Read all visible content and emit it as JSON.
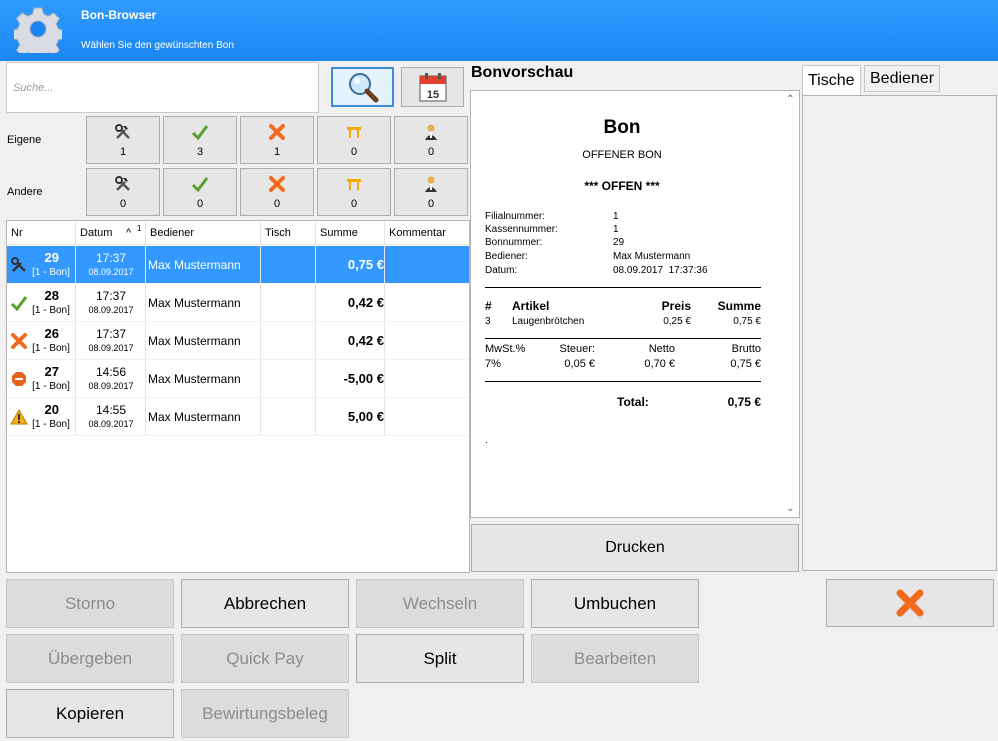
{
  "window": {
    "title": "Bon-Browser",
    "subtitle": "Wählen Sie den gewünschten Bon"
  },
  "search": {
    "placeholder": "Suche..."
  },
  "calendar_day": "15",
  "filters": {
    "own_label": "Eigene",
    "other_label": "Andere",
    "own_counts": [
      "1",
      "3",
      "1",
      "0",
      "0"
    ],
    "other_counts": [
      "0",
      "0",
      "0",
      "0",
      "0"
    ],
    "icons": [
      "tools-icon",
      "check-icon",
      "cancel-x-icon",
      "table-icon",
      "waiter-icon"
    ]
  },
  "list": {
    "columns": [
      "Nr",
      "Datum",
      "Bediener",
      "Tisch",
      "Summe",
      "Kommentar"
    ],
    "sort_indicator": "^",
    "sort_index": "1",
    "rows": [
      {
        "icon": "tools-icon",
        "nr": "29",
        "sub": "[1 - Bon]",
        "time": "17:37",
        "date": "08.09.2017",
        "waiter": "Max Mustermann",
        "table": "",
        "sum": "0,75 €",
        "comment": "",
        "selected": true
      },
      {
        "icon": "check-icon",
        "nr": "28",
        "sub": "[1 - Bon]",
        "time": "17:37",
        "date": "08.09.2017",
        "waiter": "Max Mustermann",
        "table": "",
        "sum": "0,42 €",
        "comment": "",
        "selected": false
      },
      {
        "icon": "cancel-x-icon",
        "nr": "26",
        "sub": "[1 - Bon]",
        "time": "17:37",
        "date": "08.09.2017",
        "waiter": "Max Mustermann",
        "table": "",
        "sum": "0,42 €",
        "comment": "",
        "selected": false
      },
      {
        "icon": "stop-octagon-icon",
        "nr": "27",
        "sub": "[1 - Bon]",
        "time": "14:56",
        "date": "08.09.2017",
        "waiter": "Max Mustermann",
        "table": "",
        "sum": "-5,00 €",
        "comment": "",
        "selected": false
      },
      {
        "icon": "warning-icon",
        "nr": "20",
        "sub": "[1 - Bon]",
        "time": "14:55",
        "date": "08.09.2017",
        "waiter": "Max Mustermann",
        "table": "",
        "sum": "5,00 €",
        "comment": "",
        "selected": false
      }
    ]
  },
  "preview": {
    "title": "Bonvorschau",
    "receipt": {
      "heading": "Bon",
      "type": "OFFENER BON",
      "status": "*** OFFEN ***",
      "info": [
        {
          "label": "Filialnummer:",
          "value": "1"
        },
        {
          "label": "Kassennummer:",
          "value": "1"
        },
        {
          "label": "Bonnummer:",
          "value": "29"
        },
        {
          "label": "Bediener:",
          "value": "Max Mustermann"
        },
        {
          "label": "Datum:",
          "value": "08.09.2017  17:37:36"
        }
      ],
      "item_headers": {
        "num": "#",
        "article": "Artikel",
        "price": "Preis",
        "sum": "Summe"
      },
      "items": [
        {
          "qty": "3",
          "name": "Laugenbrötchen",
          "price": "0,25 €",
          "sum": "0,75 €"
        }
      ],
      "tax_headers": {
        "rate": "MwSt.%",
        "tax": "Steuer:",
        "net": "Netto",
        "gross": "Brutto"
      },
      "tax_rows": [
        {
          "rate": "7%",
          "tax": "0,05 €",
          "net": "0,70 €",
          "gross": "0,75 €"
        }
      ],
      "total_label": "Total:",
      "total_value": "0,75 €",
      "footer": "."
    },
    "print_label": "Drucken"
  },
  "tabs": [
    "Tische",
    "Bediener"
  ],
  "actions": {
    "storno": "Storno",
    "abbrechen": "Abbrechen",
    "wechseln": "Wechseln",
    "umbuchen": "Umbuchen",
    "uebergeben": "Übergeben",
    "quickpay": "Quick Pay",
    "split": "Split",
    "bearbeiten": "Bearbeiten",
    "kopieren": "Kopieren",
    "bewirtungsbeleg": "Bewirtungsbeleg"
  },
  "colors": {
    "titlebar": "#1b86f2",
    "selection": "#3399ff",
    "close": "#f26b1d"
  }
}
